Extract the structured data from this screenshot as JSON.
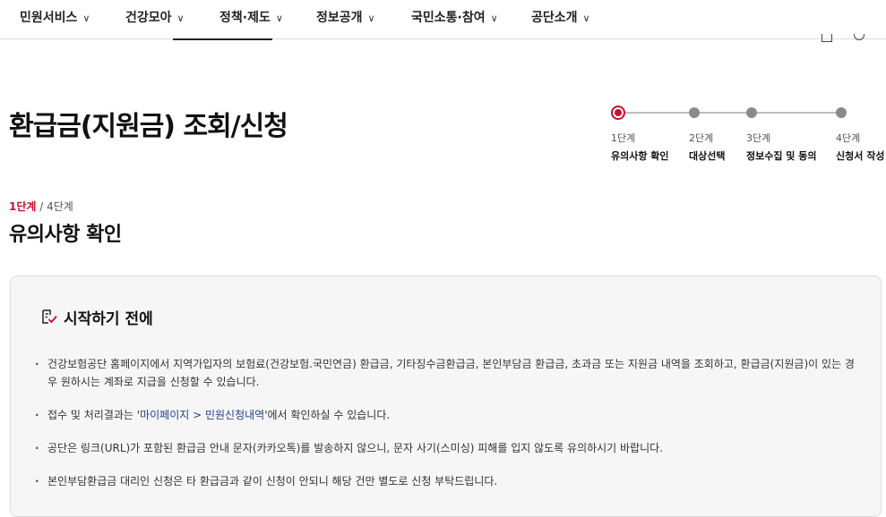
{
  "nav": {
    "items": [
      {
        "label": "민원서비스"
      },
      {
        "label": "건강모아"
      },
      {
        "label": "정책·제도"
      },
      {
        "label": "정보공개"
      },
      {
        "label": "국민소통·참여"
      },
      {
        "label": "공단소개"
      }
    ]
  },
  "page": {
    "title": "환급금(지원금) 조회/신청"
  },
  "stepper": {
    "steps": [
      {
        "num": "1단계",
        "name": "유의사항 확인",
        "state": "active"
      },
      {
        "num": "2단계",
        "name": "대상선택",
        "state": "inactive"
      },
      {
        "num": "3단계",
        "name": "정보수집 및 동의",
        "state": "inactive"
      },
      {
        "num": "4단계",
        "name": "신청서 작성",
        "state": "inactive"
      }
    ]
  },
  "current_step": {
    "current": "1단계",
    "separator": " / ",
    "total": "4단계",
    "title": "유의사항 확인"
  },
  "notice": {
    "title": "시작하기 전에",
    "icon": "checklist-icon",
    "items": {
      "i1": "건강보험공단 홈페이지에서 지역가입자의 보험료(건강보험.국민연금) 환급금, 기타징수금환급금, 본인부담금 환급금, 초과금 또는 지원금 내역을 조회하고, 환급금(지원금)이 있는 경우 원하시는 계좌로 지급을 신청할 수 있습니다.",
      "i2_before": "접수 및 처리결과는 '",
      "i2_link": "마이페이지 > 민원신청내역",
      "i2_after": "'에서 확인하실 수 있습니다.",
      "i3": "공단은 링크(URL)가 포함된 환급금 안내 문자(카카오톡)를 발송하지 않으니, 문자 사기(스미싱) 피해를 입지 않도록 유의하시기 바랍니다.",
      "i4": "본인부담환급금 대리인 신청은 타 환급금과 같이 신청이 안되니 해당 건만 별도로 신청 부탁드립니다."
    }
  },
  "colors": {
    "accent": "#c8102e",
    "link": "#1f3f8f",
    "box_bg": "#f6f6f6"
  }
}
